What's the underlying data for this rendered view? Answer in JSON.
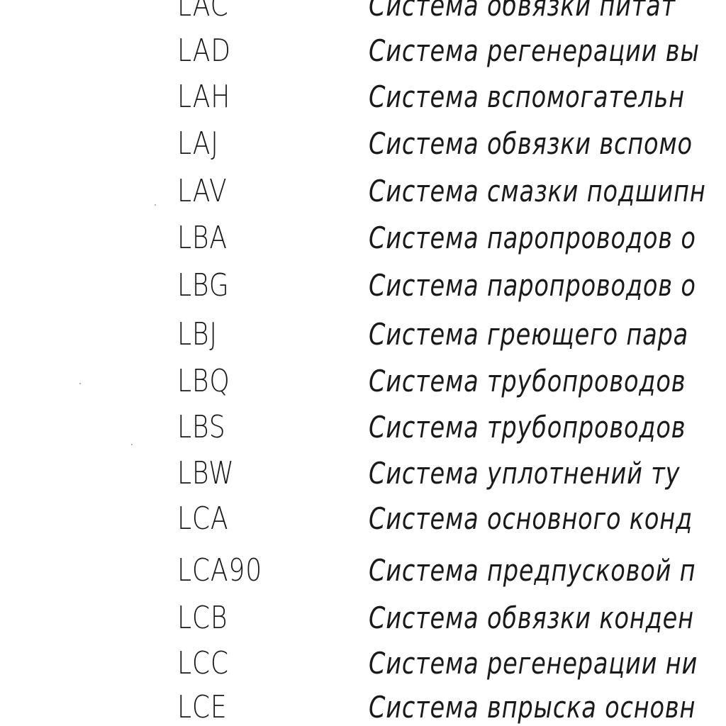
{
  "rows": [
    {
      "code": "LAC",
      "desc": "Система обвязки питат"
    },
    {
      "code": "LAD",
      "desc": "Система регенерации вы"
    },
    {
      "code": "LAH",
      "desc": "Система вспомогательн"
    },
    {
      "code": "LAJ",
      "desc": "Система обвязки вспомо"
    },
    {
      "code": "LAV",
      "desc": "Система смазки подшипн"
    },
    {
      "code": "LBA",
      "desc": "Система паропроводов о"
    },
    {
      "code": "LBG",
      "desc": "Система паропроводов о"
    },
    {
      "code": "LBJ",
      "desc": "Система греющего пара"
    },
    {
      "code": "LBQ",
      "desc": "Система трубопроводов"
    },
    {
      "code": "LBS",
      "desc": "Система трубопроводов"
    },
    {
      "code": "LBW",
      "desc": "Система уплотнений ту"
    },
    {
      "code": "LCA",
      "desc": "Система основного конд"
    },
    {
      "code": "LCA90",
      "desc": "Система предпусковой п"
    },
    {
      "code": "LCB",
      "desc": "Система обвязки конден"
    },
    {
      "code": "LCC",
      "desc": "Система регенерации ни"
    },
    {
      "code": "LCE",
      "desc": "Система впрыска основн"
    }
  ]
}
